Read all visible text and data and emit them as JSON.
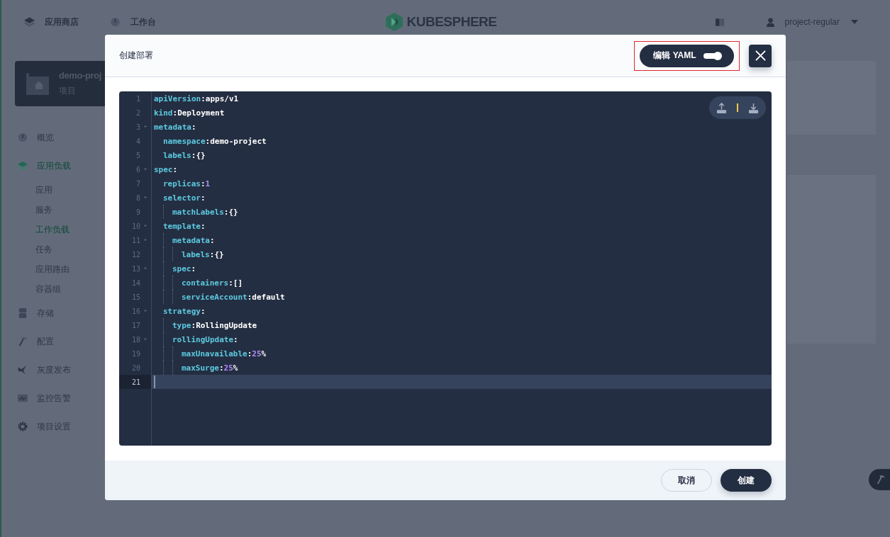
{
  "top_nav": [
    {
      "label": "应用商店"
    },
    {
      "label": "工作台"
    }
  ],
  "logo": {
    "text": "KUBESPHERE"
  },
  "user": {
    "name": "project-regular"
  },
  "project": {
    "name": "demo-proj",
    "subtitle": "项目"
  },
  "sidebar": [
    {
      "label": "概览",
      "kind": "group",
      "selected": false
    },
    {
      "label": "应用负载",
      "kind": "group",
      "selected": true
    },
    {
      "label": "应用",
      "kind": "sub",
      "selected": false
    },
    {
      "label": "服务",
      "kind": "sub",
      "selected": false
    },
    {
      "label": "工作负载",
      "kind": "sub",
      "selected": true
    },
    {
      "label": "任务",
      "kind": "sub",
      "selected": false
    },
    {
      "label": "应用路由",
      "kind": "sub",
      "selected": false
    },
    {
      "label": "容器组",
      "kind": "sub",
      "selected": false
    },
    {
      "label": "存储",
      "kind": "group",
      "selected": false
    },
    {
      "label": "配置",
      "kind": "group",
      "selected": false
    },
    {
      "label": "灰度发布",
      "kind": "group",
      "selected": false
    },
    {
      "label": "监控告警",
      "kind": "group",
      "selected": false
    },
    {
      "label": "项目设置",
      "kind": "group",
      "selected": false
    }
  ],
  "modal": {
    "title": "创建部署",
    "yaml_toggle": {
      "label": "编辑 YAML",
      "on": true
    },
    "editor": {
      "lines": [
        {
          "line_number": "1",
          "key": "apiVersion",
          "sep": ":",
          "value": [
            {
              "text": "apps/v1",
              "kind": "plain"
            }
          ]
        },
        {
          "line_number": "2",
          "key": "kind",
          "sep": ":",
          "value": [
            {
              "text": "Deployment",
              "kind": "plain"
            }
          ]
        },
        {
          "line_number": "3",
          "key": "metadata",
          "sep": ":",
          "expanded": true,
          "children": [
            {
              "line_number": "4",
              "key": "namespace",
              "sep": ":",
              "value": [
                {
                  "text": "demo-project",
                  "kind": "plain"
                }
              ]
            },
            {
              "line_number": "5",
              "key": "labels",
              "sep": ":",
              "value": [
                {
                  "text": "{}",
                  "kind": "plain"
                }
              ]
            }
          ]
        },
        {
          "line_number": "6",
          "key": "spec",
          "sep": ":",
          "expanded": true,
          "children": [
            {
              "line_number": "7",
              "key": "replicas",
              "sep": ":",
              "value": [
                {
                  "text": "1",
                  "kind": "number"
                }
              ]
            },
            {
              "line_number": "8",
              "key": "selector",
              "sep": ":",
              "expanded": true,
              "children": [
                {
                  "line_number": "9",
                  "key": "matchLabels",
                  "sep": ":",
                  "value": [
                    {
                      "text": "{}",
                      "kind": "plain"
                    }
                  ]
                }
              ]
            },
            {
              "line_number": "10",
              "key": "template",
              "sep": ":",
              "expanded": true,
              "children": [
                {
                  "line_number": "11",
                  "key": "metadata",
                  "sep": ":",
                  "expanded": true,
                  "children": [
                    {
                      "line_number": "12",
                      "key": "labels",
                      "sep": ":",
                      "value": [
                        {
                          "text": "{}",
                          "kind": "plain"
                        }
                      ]
                    }
                  ]
                },
                {
                  "line_number": "13",
                  "key": "spec",
                  "sep": ":",
                  "expanded": true,
                  "children": [
                    {
                      "line_number": "14",
                      "key": "containers",
                      "sep": ":",
                      "value": [
                        {
                          "text": "[]",
                          "kind": "plain"
                        }
                      ]
                    },
                    {
                      "line_number": "15",
                      "key": "serviceAccount",
                      "sep": ":",
                      "value": [
                        {
                          "text": "default",
                          "kind": "plain"
                        }
                      ]
                    }
                  ]
                }
              ]
            },
            {
              "line_number": "16",
              "key": "strategy",
              "sep": ":",
              "expanded": true,
              "children": [
                {
                  "line_number": "17",
                  "key": "type",
                  "sep": ":",
                  "value": [
                    {
                      "text": "RollingUpdate",
                      "kind": "plain"
                    }
                  ]
                },
                {
                  "line_number": "18",
                  "key": "rollingUpdate",
                  "sep": ":",
                  "expanded": true,
                  "children": [
                    {
                      "line_number": "19",
                      "key": "maxUnavailable",
                      "sep": ":",
                      "value": [
                        {
                          "text": "25",
                          "kind": "number"
                        },
                        {
                          "text": "%",
                          "kind": "plain"
                        }
                      ]
                    },
                    {
                      "line_number": "20",
                      "key": "maxSurge",
                      "sep": ":",
                      "value": [
                        {
                          "text": "25",
                          "kind": "number"
                        },
                        {
                          "text": "%",
                          "kind": "plain"
                        }
                      ]
                    }
                  ]
                }
              ]
            }
          ]
        }
      ],
      "cursor_line": {
        "line_number": "21"
      }
    },
    "buttons": [
      {
        "label": "取消",
        "kind": "secondary"
      },
      {
        "label": "创建",
        "kind": "primary"
      }
    ]
  }
}
